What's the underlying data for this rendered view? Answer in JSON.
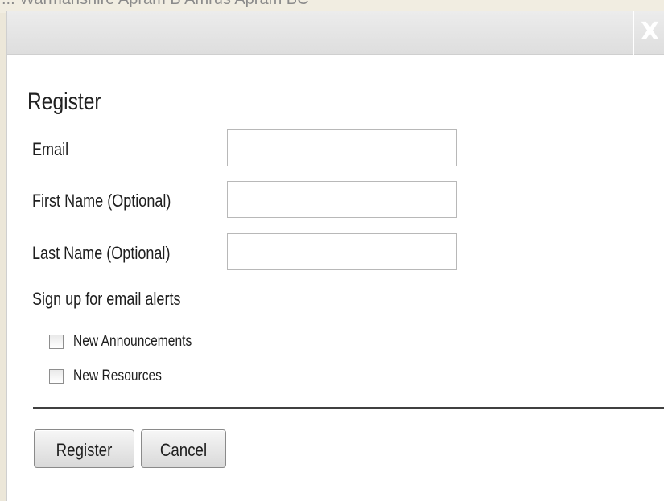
{
  "background": {
    "partial_text": "... Warmanshire   Apram B   Amrus Apram BC"
  },
  "dialog": {
    "close_glyph": "X",
    "title": "Register",
    "fields": {
      "email_label": "Email",
      "email_value": "",
      "first_name_label": "First Name (Optional)",
      "first_name_value": "",
      "last_name_label": "Last Name (Optional)",
      "last_name_value": ""
    },
    "alerts": {
      "heading": "Sign up for email alerts",
      "options": [
        {
          "label": "New Announcements",
          "checked": false
        },
        {
          "label": "New Resources",
          "checked": false
        }
      ]
    },
    "buttons": {
      "register_label": "Register",
      "cancel_label": "Cancel"
    }
  },
  "colors": {
    "page_background": "#ece7d9",
    "titlebar": "#e4e4e4",
    "divider": "#404040"
  },
  "icons": {
    "close": "close-icon"
  }
}
